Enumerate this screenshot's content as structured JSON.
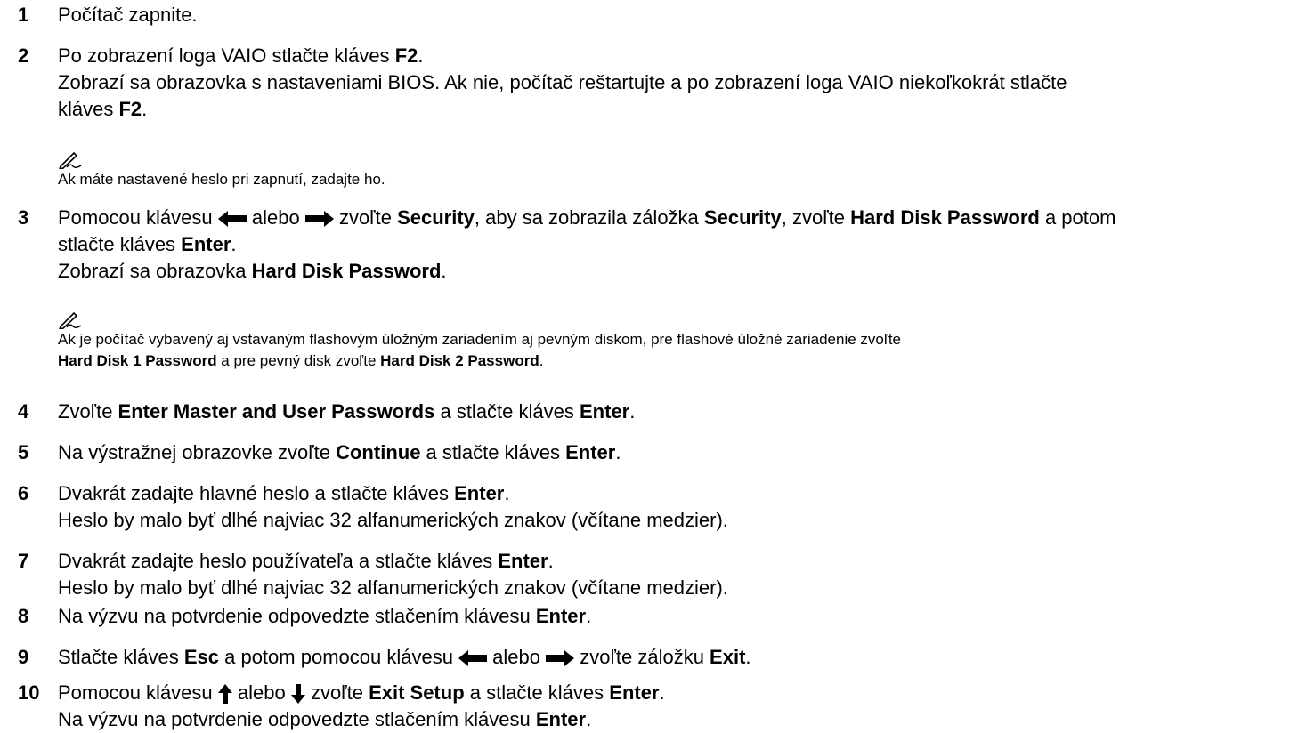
{
  "steps": {
    "s1": {
      "num": "1",
      "t": "Počítač zapnite."
    },
    "s2": {
      "num": "2",
      "a": "Po zobrazení loga VAIO stlačte kláves ",
      "k": "F2",
      "b": ".",
      "line2": "Zobrazí sa obrazovka s nastaveniami BIOS. Ak nie, počítač reštartujte a po zobrazení loga VAIO niekoľkokrát stlačte",
      "line3a": "kláves ",
      "line3k": "F2",
      "line3b": "."
    },
    "s3": {
      "num": "3",
      "a": "Pomocou klávesu ",
      "b": " alebo ",
      "c": " zvoľte ",
      "k1": "Security",
      "d": ", aby sa zobrazila záložka ",
      "k2": "Security",
      "e": ", zvoľte ",
      "k3": "Hard Disk Password",
      "f": " a potom",
      "line2a": "stlačte kláves ",
      "line2k": "Enter",
      "line2b": ".",
      "line3a": "Zobrazí sa obrazovka ",
      "line3k": "Hard Disk Password",
      "line3b": "."
    },
    "s4": {
      "num": "4",
      "a": "Zvoľte ",
      "k1": "Enter Master and User Passwords",
      "b": " a stlačte kláves ",
      "k2": "Enter",
      "c": "."
    },
    "s5": {
      "num": "5",
      "a": "Na výstražnej obrazovke zvoľte ",
      "k1": "Continue",
      "b": " a stlačte kláves ",
      "k2": "Enter",
      "c": "."
    },
    "s6": {
      "num": "6",
      "a": "Dvakrát zadajte hlavné heslo a stlačte kláves ",
      "k": "Enter",
      "b": ".",
      "line2": "Heslo by malo byť dlhé najviac 32 alfanumerických znakov (včítane medzier)."
    },
    "s7": {
      "num": "7",
      "a": "Dvakrát zadajte heslo používateľa a stlačte kláves ",
      "k": "Enter",
      "b": ".",
      "line2": "Heslo by malo byť dlhé najviac 32 alfanumerických znakov (včítane medzier)."
    },
    "s8": {
      "num": "8",
      "a": "Na výzvu na potvrdenie odpovedzte stlačením klávesu ",
      "k": "Enter",
      "b": "."
    },
    "s9": {
      "num": "9",
      "a": "Stlačte kláves ",
      "k1": "Esc",
      "b": " a potom pomocou klávesu ",
      "c": " alebo ",
      "d": " zvoľte záložku ",
      "k2": "Exit",
      "e": "."
    },
    "s10": {
      "num": "10",
      "a": "Pomocou klávesu ",
      "b": " alebo ",
      "c": " zvoľte ",
      "k1": "Exit Setup",
      "d": " a stlačte kláves ",
      "k2": "Enter",
      "e": ".",
      "line2a": "Na výzvu na potvrdenie odpovedzte stlačením klávesu ",
      "line2k": "Enter",
      "line2b": "."
    }
  },
  "notes": {
    "n1": "Ak máte nastavené heslo pri zapnutí, zadajte ho.",
    "n2a": "Ak je počítač vybavený aj vstavaným flashovým úložným zariadením aj pevným diskom, pre flashové úložné zariadenie zvoľte",
    "n2b1": "Hard Disk 1 Password",
    "n2b2": " a pre pevný disk zvoľte ",
    "n2b3": "Hard Disk 2 Password",
    "n2b4": "."
  },
  "icons": {
    "note": "pen-note-icon",
    "left": "arrow-left-icon",
    "right": "arrow-right-icon",
    "up": "arrow-up-icon",
    "down": "arrow-down-icon"
  }
}
